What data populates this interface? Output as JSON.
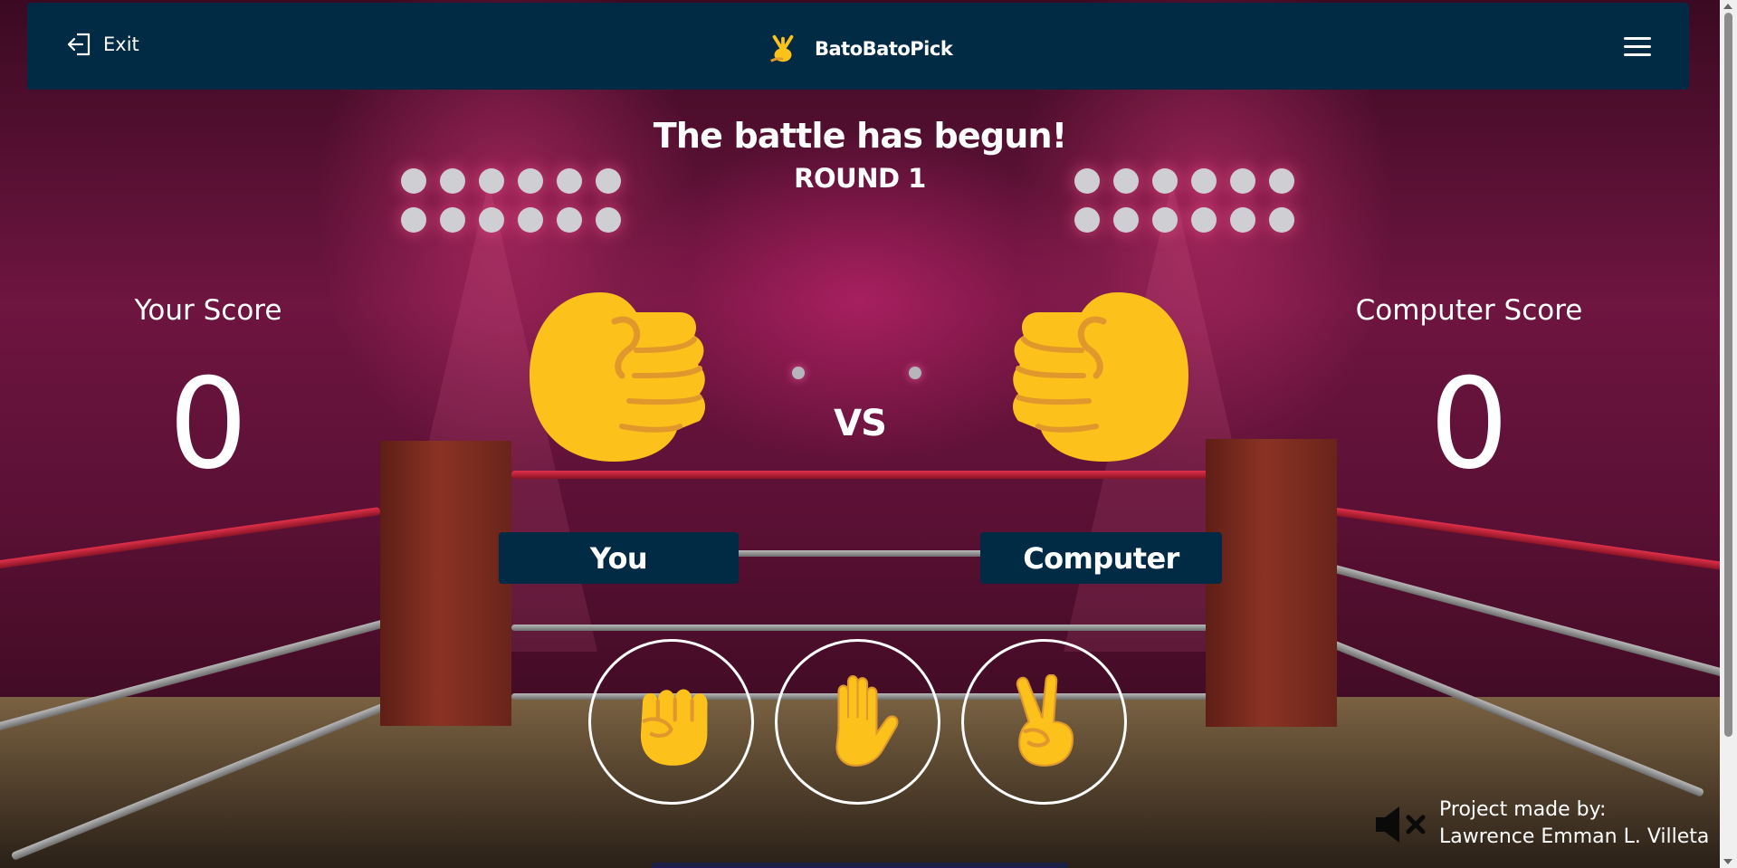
{
  "header": {
    "exit_label": "Exit",
    "brand_label": "BatoBatoPick",
    "menu_icon": "hamburger-menu-icon"
  },
  "game": {
    "title": "The battle has begun!",
    "round": "ROUND 1",
    "vs": "VS"
  },
  "scores": {
    "player_label": "Your Score",
    "player_value": "0",
    "computer_label": "Computer Score",
    "computer_value": "0"
  },
  "players": {
    "player_name": "You",
    "computer_name": "Computer"
  },
  "choices": [
    {
      "name": "rock",
      "icon": "raised-fist-icon"
    },
    {
      "name": "paper",
      "icon": "raised-hand-icon"
    },
    {
      "name": "scissors",
      "icon": "victory-hand-icon"
    }
  ],
  "footer": {
    "credit_line1": "Project made by:",
    "credit_line2": "Lawrence Emman L. Villeta",
    "sound_state": "muted"
  },
  "colors": {
    "header_bg": "#012a44",
    "emoji_yellow": "#fcc21b",
    "emoji_outline": "#e0982c"
  }
}
